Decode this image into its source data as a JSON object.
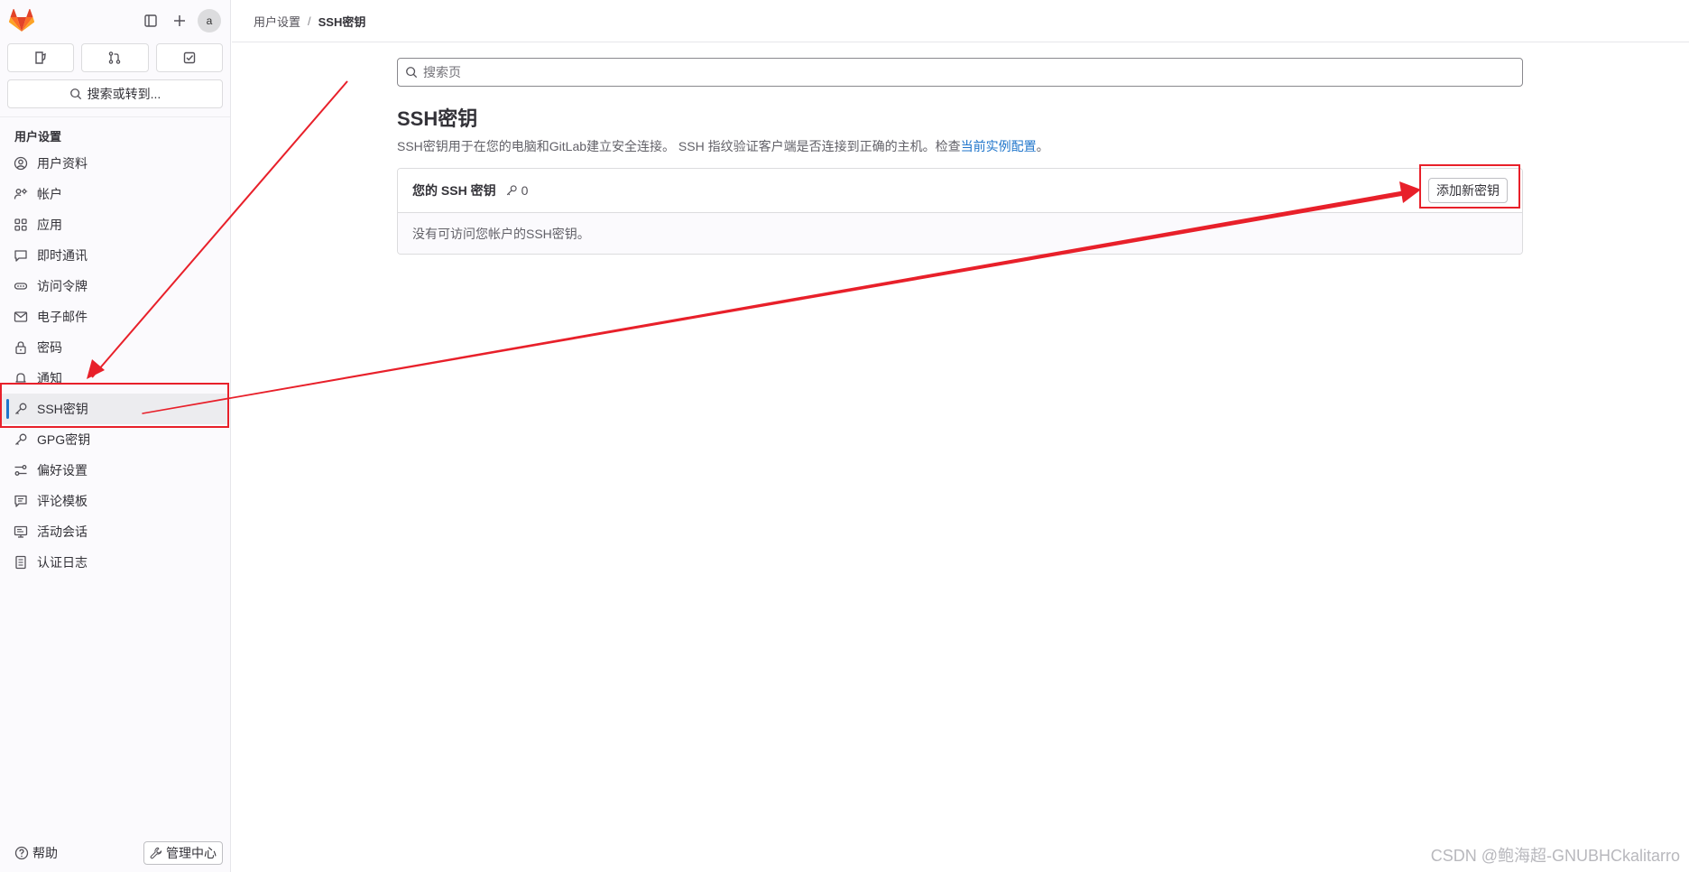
{
  "sidebar": {
    "avatar_alt": "a",
    "search_label": "搜索或转到...",
    "section_title": "用户设置",
    "items": [
      {
        "label": "用户资料"
      },
      {
        "label": "帐户"
      },
      {
        "label": "应用"
      },
      {
        "label": "即时通讯"
      },
      {
        "label": "访问令牌"
      },
      {
        "label": "电子邮件"
      },
      {
        "label": "密码"
      },
      {
        "label": "通知"
      },
      {
        "label": "SSH密钥"
      },
      {
        "label": "GPG密钥"
      },
      {
        "label": "偏好设置"
      },
      {
        "label": "评论模板"
      },
      {
        "label": "活动会话"
      },
      {
        "label": "认证日志"
      }
    ],
    "help_label": "帮助",
    "admin_label": "管理中心"
  },
  "breadcrumb": {
    "parent": "用户设置",
    "current": "SSH密钥"
  },
  "main": {
    "search_placeholder": "搜索页",
    "title": "SSH密钥",
    "description": "SSH密钥用于在您的电脑和GitLab建立安全连接。 SSH 指纹验证客户端是否连接到正确的主机。检查",
    "description_link": "当前实例配置",
    "description_end": "。",
    "card": {
      "title": "您的 SSH 密钥",
      "count": "0",
      "add_button": "添加新密钥",
      "empty_text": "没有可访问您帐户的SSH密钥。"
    }
  },
  "watermark": "CSDN @鲍海超-GNUBHCkalitarro",
  "colors": {
    "accent": "#1f75cb",
    "annotation": "#e8202a",
    "logo_orange": "#e24329"
  }
}
